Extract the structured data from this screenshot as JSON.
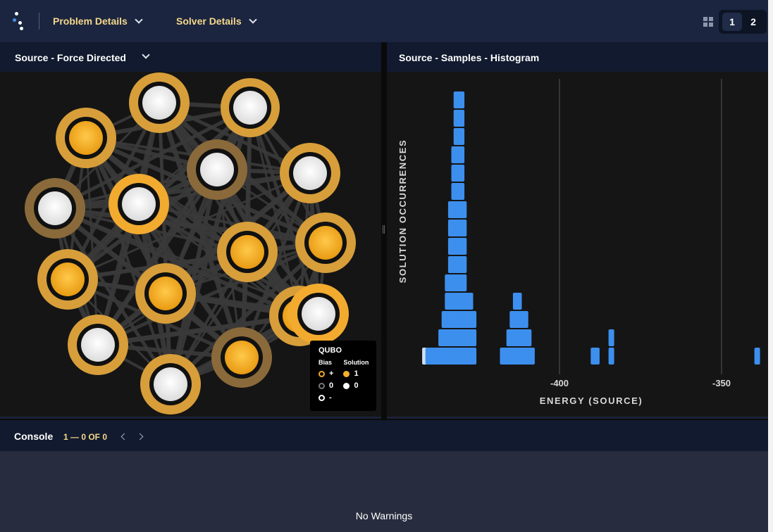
{
  "topbar": {
    "menu_problem": "Problem Details",
    "menu_solver": "Solver Details",
    "page_1": "1",
    "page_2": "2"
  },
  "left_panel": {
    "title": "Source - Force Directed"
  },
  "right_panel": {
    "title": "Source - Samples - Histogram"
  },
  "legend": {
    "title": "QUBO",
    "bias_header": "Bias",
    "solution_header": "Solution",
    "bias_items": [
      "+",
      "0",
      "-"
    ],
    "solution_items": [
      "1",
      "0"
    ]
  },
  "graph": {
    "node_count": 16,
    "nodes": [
      {
        "bias": "+",
        "solution": 0
      },
      {
        "bias": "+",
        "solution": 0
      },
      {
        "bias": "+",
        "solution": 1
      },
      {
        "bias": "0",
        "solution": 0
      },
      {
        "bias": "+",
        "solution": 0
      },
      {
        "bias": "0",
        "solution": 0
      },
      {
        "bias": "+",
        "solution": 0
      },
      {
        "bias": "+",
        "solution": 1
      },
      {
        "bias": "+",
        "solution": 1
      },
      {
        "bias": "+",
        "solution": 1
      },
      {
        "bias": "+",
        "solution": 1
      },
      {
        "bias": "+",
        "solution": 1
      },
      {
        "bias": "+",
        "solution": 0
      },
      {
        "bias": "0",
        "solution": 1
      },
      {
        "bias": "+",
        "solution": 0
      },
      {
        "bias": "+",
        "solution": 0
      }
    ],
    "colors": {
      "edge": "#3a3a3a",
      "ring": "#d79e3a",
      "ring_strong": "#f2ab2f",
      "ring_zero": "#8a6a3a",
      "solution_one": "#f4b02a",
      "solution_zero": "#ffffff"
    }
  },
  "chart_data": {
    "type": "bar",
    "title": "",
    "xlabel": "ENERGY (SOURCE)",
    "ylabel": "SOLUTION OCCURRENCES",
    "x_ticks": [
      -400,
      -350
    ],
    "bars": [
      {
        "energy": -441.5,
        "count": 1,
        "highlight": true
      },
      {
        "energy": -440.5,
        "count": 1
      },
      {
        "energy": -439.5,
        "count": 1
      },
      {
        "energy": -438.5,
        "count": 1
      },
      {
        "energy": -437.5,
        "count": 1
      },
      {
        "energy": -436.5,
        "count": 2
      },
      {
        "energy": -435.5,
        "count": 3
      },
      {
        "energy": -434.5,
        "count": 5
      },
      {
        "energy": -433.5,
        "count": 9
      },
      {
        "energy": -432.5,
        "count": 12
      },
      {
        "energy": -431.8,
        "count": 15
      },
      {
        "energy": -431.0,
        "count": 15
      },
      {
        "energy": -430.2,
        "count": 15
      },
      {
        "energy": -429.5,
        "count": 9
      },
      {
        "energy": -428.5,
        "count": 4
      },
      {
        "energy": -427.5,
        "count": 4
      },
      {
        "energy": -426.5,
        "count": 3
      },
      {
        "energy": -417.5,
        "count": 1
      },
      {
        "energy": -416.5,
        "count": 1
      },
      {
        "energy": -415.5,
        "count": 2
      },
      {
        "energy": -414.5,
        "count": 3
      },
      {
        "energy": -413.5,
        "count": 4
      },
      {
        "energy": -412.5,
        "count": 4
      },
      {
        "energy": -411.5,
        "count": 3
      },
      {
        "energy": -410.5,
        "count": 3
      },
      {
        "energy": -409.5,
        "count": 2
      },
      {
        "energy": -408.5,
        "count": 1
      },
      {
        "energy": -389.5,
        "count": 1
      },
      {
        "energy": -388.5,
        "count": 1
      },
      {
        "energy": -384.0,
        "count": 2
      },
      {
        "energy": -339.0,
        "count": 1
      }
    ],
    "colors": {
      "bar": "#3d8fee",
      "bar_highlight": "#cfe0f5",
      "gridline": "#555555",
      "label": "#d8d8d8"
    },
    "grid": true
  },
  "console": {
    "title": "Console",
    "count": "1 — 0 OF 0",
    "message": "No Warnings"
  }
}
